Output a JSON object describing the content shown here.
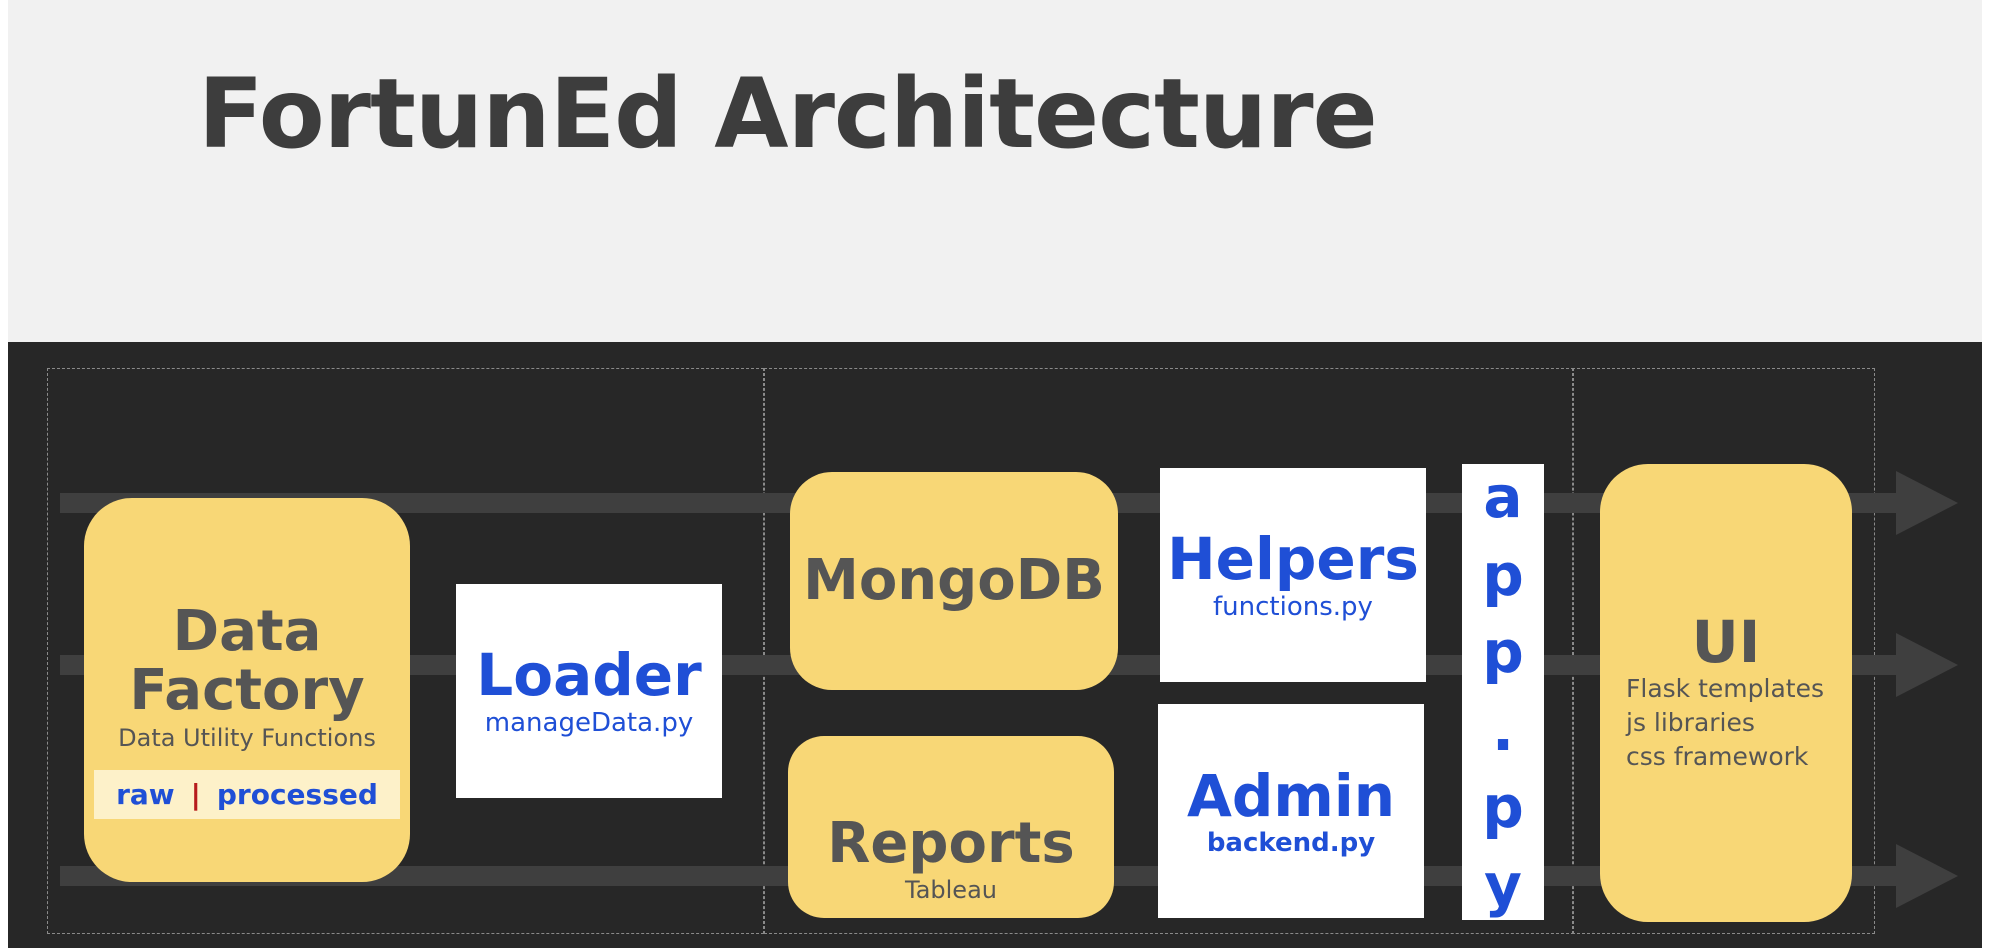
{
  "title": "FortunEd Architecture",
  "data_factory": {
    "title_line1": "Data",
    "title_line2": "Factory",
    "subtitle": "Data Utility Functions",
    "tag_left": "raw",
    "tag_sep": "|",
    "tag_right": "processed"
  },
  "loader": {
    "title": "Loader",
    "file": "manageData.py"
  },
  "mongodb": {
    "title": "MongoDB"
  },
  "reports": {
    "title": "Reports",
    "subtitle": "Tableau"
  },
  "helpers": {
    "title": "Helpers",
    "file": "functions.py"
  },
  "admin": {
    "title": "Admin",
    "file": "backend.py"
  },
  "app": {
    "chars": [
      "a",
      "p",
      "p",
      ".",
      "p",
      "y"
    ]
  },
  "ui": {
    "title": "UI",
    "lines": [
      "Flask templates",
      "js libraries",
      "css framework"
    ]
  },
  "colors": {
    "title_bg": "#f1f1f1",
    "dark_bg": "#272727",
    "yellow": "#f8d776",
    "blue_text": "#1f4fd6",
    "grey_text": "#555555",
    "separator_red": "#b71c1c"
  }
}
